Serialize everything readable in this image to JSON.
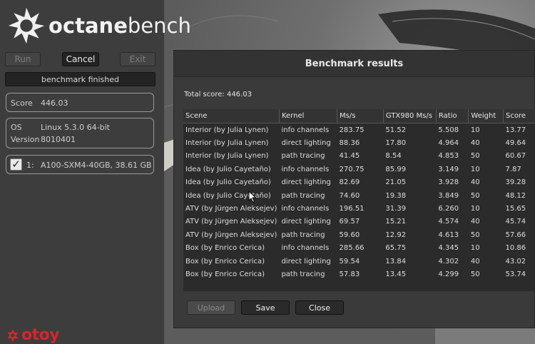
{
  "app": {
    "logo_text_bold": "octane",
    "logo_text_light": "bench",
    "vendor_logo": "otoy"
  },
  "controls": {
    "run_label": "Run",
    "cancel_label": "Cancel",
    "exit_label": "Exit",
    "status_text": "benchmark finished"
  },
  "info": {
    "score_label": "Score",
    "score_value": "446.03",
    "os_label": "OS",
    "os_value": "Linux 5.3.0 64-bit",
    "version_label": "Version",
    "version_value": "8010401",
    "device_index": "1:",
    "device_name": "A100-SXM4-40GB, 38.61 GB",
    "device_checked": true
  },
  "dialog": {
    "title": "Benchmark results",
    "total_score": "Total score: 446.03",
    "columns": [
      "Scene",
      "Kernel",
      "Ms/s",
      "GTX980 Ms/s",
      "Ratio",
      "Weight",
      "Score"
    ],
    "rows": [
      [
        "Interior (by Julia Lynen)",
        "info channels",
        "283.75",
        "51.52",
        "5.508",
        "10",
        "13.77"
      ],
      [
        "Interior (by Julia Lynen)",
        "direct lighting",
        "88.36",
        "17.80",
        "4.964",
        "40",
        "49.64"
      ],
      [
        "Interior (by Julia Lynen)",
        "path tracing",
        "41.45",
        "8.54",
        "4.853",
        "50",
        "60.67"
      ],
      [
        "Idea (by Julio Cayetaño)",
        "info channels",
        "270.75",
        "85.99",
        "3.149",
        "10",
        "7.87"
      ],
      [
        "Idea (by Julio Cayetaño)",
        "direct lighting",
        "82.69",
        "21.05",
        "3.928",
        "40",
        "39.28"
      ],
      [
        "Idea (by Julio Cayetaño)",
        "path tracing",
        "74.60",
        "19.38",
        "3.849",
        "50",
        "48.12"
      ],
      [
        "ATV (by Jürgen Aleksejev)",
        "info channels",
        "196.51",
        "31.39",
        "6.260",
        "10",
        "15.65"
      ],
      [
        "ATV (by Jürgen Aleksejev)",
        "direct lighting",
        "69.57",
        "15.21",
        "4.574",
        "40",
        "45.74"
      ],
      [
        "ATV (by Jürgen Aleksejev)",
        "path tracing",
        "59.60",
        "12.92",
        "4.613",
        "50",
        "57.66"
      ],
      [
        "Box (by Enrico Cerica)",
        "info channels",
        "285.66",
        "65.75",
        "4.345",
        "10",
        "10.86"
      ],
      [
        "Box (by Enrico Cerica)",
        "direct lighting",
        "59.54",
        "13.84",
        "4.302",
        "40",
        "43.02"
      ],
      [
        "Box (by Enrico Cerica)",
        "path tracing",
        "57.83",
        "13.45",
        "4.299",
        "50",
        "53.74"
      ]
    ],
    "upload_label": "Upload",
    "save_label": "Save",
    "close_label": "Close"
  },
  "colors": {
    "vendor_red": "#d4262a",
    "panel_bg": "#3d3d3d",
    "table_bg": "#2b2b2b"
  }
}
